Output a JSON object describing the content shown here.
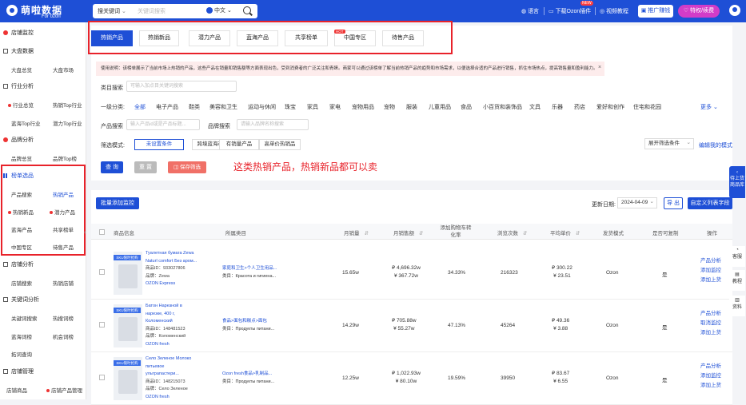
{
  "header": {
    "logo_text": "萌啦数据",
    "logo_sub": "For ozon",
    "search_mode": "搜关键词",
    "search_placeholder": "关键词搜索",
    "search_lang": "中文",
    "language": "语言",
    "download": "下载Ozon插件",
    "download_badge": "NEW",
    "video": "视频教程",
    "promo": "推广赚钱",
    "vip": "特权/续费"
  },
  "sidebar": {
    "items": [
      {
        "label": "店铺监控",
        "type": "section"
      },
      {
        "label": "大盘数据",
        "type": "section"
      },
      {
        "label": "大盘总览",
        "type": "sub"
      },
      {
        "label": "大盘市场",
        "type": "sub"
      },
      {
        "label": "行业分析",
        "type": "section"
      },
      {
        "label": "行业总览",
        "type": "sub"
      },
      {
        "label": "热销Top行业",
        "type": "sub"
      },
      {
        "label": "蓝海Top行业",
        "type": "sub"
      },
      {
        "label": "潜力Top行业",
        "type": "sub"
      },
      {
        "label": "品牌分析",
        "type": "section"
      },
      {
        "label": "品牌总览",
        "type": "sub"
      },
      {
        "label": "品牌Top榜",
        "type": "sub"
      },
      {
        "label": "榜单选品",
        "type": "section"
      },
      {
        "label": "产品搜索",
        "type": "sub"
      },
      {
        "label": "热销产品",
        "type": "sub"
      },
      {
        "label": "热销新品",
        "type": "sub"
      },
      {
        "label": "潜力产品",
        "type": "sub"
      },
      {
        "label": "蓝海产品",
        "type": "sub"
      },
      {
        "label": "共享榜单",
        "type": "sub"
      },
      {
        "label": "中国专区",
        "type": "sub"
      },
      {
        "label": "待售产品",
        "type": "sub"
      },
      {
        "label": "店铺分析",
        "type": "section"
      },
      {
        "label": "店铺搜索",
        "type": "sub"
      },
      {
        "label": "热销店铺",
        "type": "sub"
      },
      {
        "label": "关键词分析",
        "type": "section"
      },
      {
        "label": "关键词搜索",
        "type": "sub"
      },
      {
        "label": "热搜词榜",
        "type": "sub"
      },
      {
        "label": "蓝海词榜",
        "type": "sub"
      },
      {
        "label": "机会词榜",
        "type": "sub"
      },
      {
        "label": "拓词查询",
        "type": "sub"
      },
      {
        "label": "店铺管理",
        "type": "section"
      },
      {
        "label": "店铺商品",
        "type": "sub"
      },
      {
        "label": "店铺产品管理",
        "type": "sub"
      }
    ]
  },
  "tabs": [
    "热销产品",
    "热销新品",
    "潜力产品",
    "蓝海产品",
    "共享榜单",
    "中国专区",
    "待售产品"
  ],
  "tab_hot_badge": "HOT",
  "notice": "使用说明：该榜单展示了当前市场上热销的产品，这些产品在销量和销售额等方面表现出色，受到消费者的广泛关注和青睐。商家可以通过该榜单了解当前热销产品的趋势和市场需求，以便选择合适的产品进行销售，抓住市场热点，提高销售量和盈利能力。",
  "filters": {
    "category_search_label": "类目搜索",
    "category_search_placeholder": "可输入加点目关键词搜索",
    "level1_label": "一级分类:",
    "categories": [
      "全部",
      "电子产品",
      "鞋类",
      "美容和卫生",
      "运动与休闲",
      "珠宝",
      "家具",
      "家电",
      "宠物用品",
      "宠物",
      "服装",
      "儿童用品",
      "食品",
      "小百货和装饰品",
      "文具",
      "乐器",
      "药店",
      "爱好和创作",
      "住宅和花园"
    ],
    "more": "更多",
    "product_search_label": "产品搜索",
    "product_search_placeholder": "输入产品id或是产品标题...",
    "brand_search_label": "品牌搜索",
    "brand_search_placeholder": "请输入品牌名称搜索",
    "mode_label": "筛选模式:",
    "modes": [
      "未设置条件",
      "跨境蓝海市场",
      "有销量产品",
      "高单价热销品"
    ],
    "expand": "展开筛选条件",
    "edit_mode": "编辑我的模式",
    "query": "查 询",
    "reset": "重 置",
    "save": "保存筛选"
  },
  "annotation": "这类热销产品，热销新品都可以卖",
  "toolbar": {
    "batch_add": "批量添加监控",
    "update_label": "更新日期:",
    "update_date": "2024-04-09",
    "export": "导 出",
    "custom": "自定义列表字段"
  },
  "table": {
    "columns": [
      "商品信息",
      "所属类目",
      "月销量",
      "月销售额",
      "添加购物车转化率",
      "浏览次数",
      "平均单价",
      "发货模式",
      "是否可复制",
      "操作"
    ],
    "rows": [
      {
        "tag": "SKU限时抢购",
        "title": "Туалетная бумага Zewa Naturl comfort Без аром...",
        "id": "商品ID：933027806",
        "brand": "品牌：Zewa",
        "shop": "OZON Express",
        "cat1": "家庭和卫生>个人卫生用品...",
        "cat2": "类目：Красота и гигиена...",
        "month_sales": "15.65w",
        "sales1": "₽ 4,696.32w",
        "sales2": "¥ 367.72w",
        "conv": "34.33%",
        "views": "216323",
        "price1": "₽ 300.22",
        "price2": "¥ 23.51",
        "ship": "Ozon",
        "copy": "是",
        "ops": [
          "产品分析",
          "添加监控",
          "添加上货"
        ]
      },
      {
        "tag": "SKU限时抢购",
        "title": "Батон Нарезной в нарезке, 400 г, Коломенский",
        "id": "商品ID：148481523",
        "brand": "品牌：Коломенский",
        "shop": "OZON fresh",
        "cat1": "食品>面包和糕点>面包",
        "cat2": "类目：Продукты питани...",
        "month_sales": "14.29w",
        "sales1": "₽ 705.88w",
        "sales2": "¥ 55.27w",
        "conv": "47.13%",
        "views": "45264",
        "price1": "₽ 49.36",
        "price2": "¥ 3.88",
        "ship": "Ozon",
        "copy": "是",
        "ops": [
          "产品分析",
          "取消监控",
          "添加上货"
        ]
      },
      {
        "tag": "SKU限时抢购",
        "title": "Село Зеленое Молоко питьевое ультрапастери...",
        "id": "商品ID：148215073",
        "brand": "品牌：Село Зеленое",
        "shop": "OZON fresh",
        "cat1": "Ozon fresh食品>乳制品...",
        "cat2": "类目：Продукты питани...",
        "month_sales": "12.25w",
        "sales1": "₽ 1,022.93w",
        "sales2": "¥ 80.10w",
        "conv": "19.59%",
        "views": "39950",
        "price1": "₽ 83.67",
        "price2": "¥ 6.55",
        "ship": "Ozon",
        "copy": "是",
        "ops": [
          "产品分析",
          "添加监控",
          "添加上货"
        ]
      }
    ]
  },
  "right_float": {
    "pending": "待上货商品库",
    "service": "客服",
    "tutorial": "教程",
    "material": "资料"
  },
  "colors": {
    "primary": "#1e4fd6",
    "annotation_red": "#e8222a",
    "vip": "#d23cc8"
  }
}
